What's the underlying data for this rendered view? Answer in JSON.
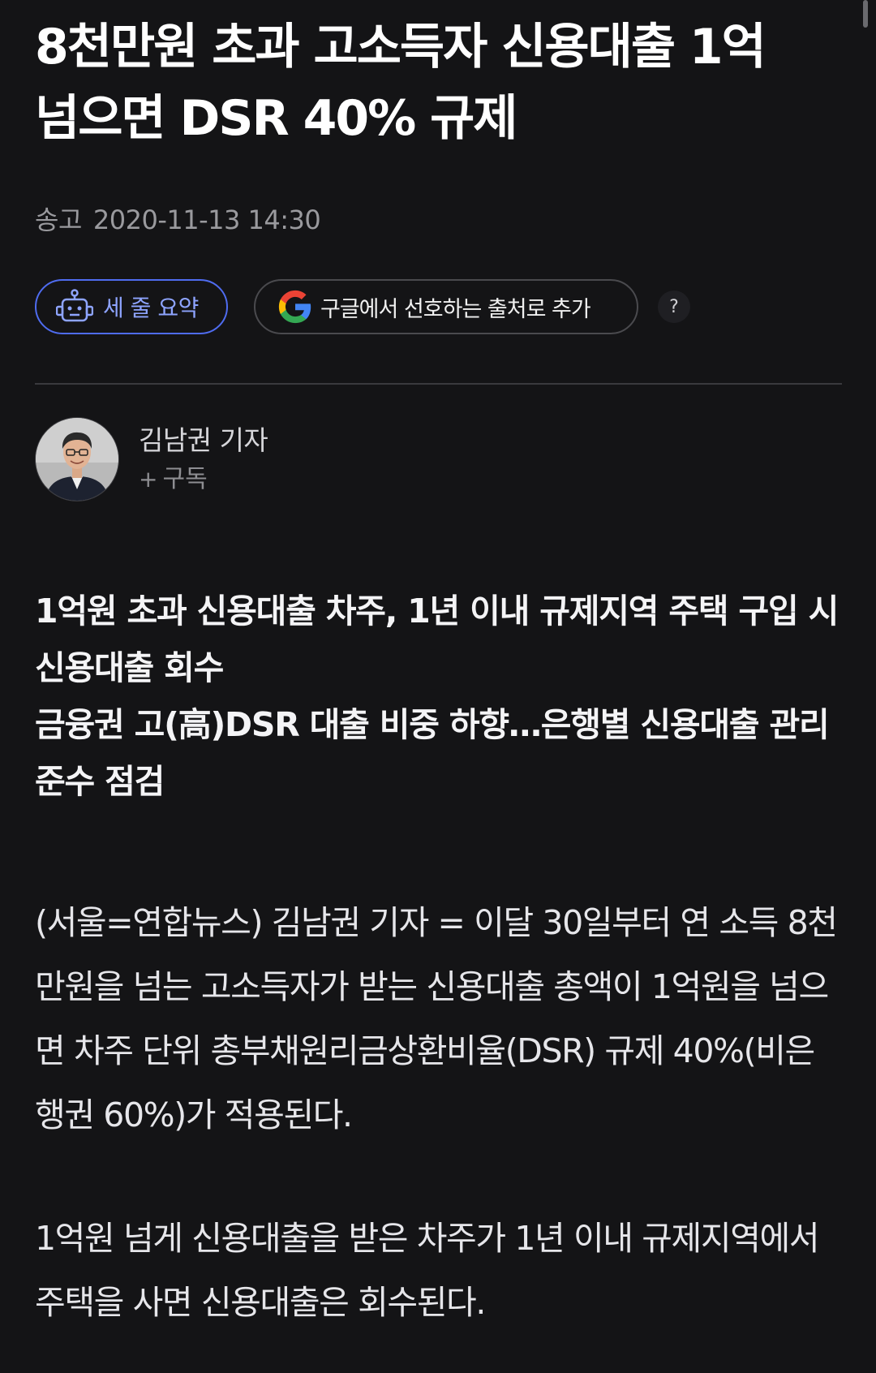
{
  "article": {
    "headline": "8천만원 초과 고소득자 신용대출 1억\n넘으면 DSR 40% 규제",
    "dateline_label": "송고",
    "dateline_value": "2020-11-13 14:30"
  },
  "actions": {
    "summary_label": "세 줄 요약",
    "google_label": "구글에서 선호하는 출처로 추가",
    "help_label": "?"
  },
  "author": {
    "name": "김남권 기자",
    "subscribe_label": "구독"
  },
  "subheads": [
    "1억원 초과 신용대출 차주, 1년 이내 규제지역 주택 구입 시 신용대출 회수",
    "금융권 고(高)DSR 대출 비중 하향…은행별 신용대출 관리 준수 점검"
  ],
  "body": [
    "(서울=연합뉴스) 김남권 기자 = 이달 30일부터 연 소득 8천만원을 넘는 고소득자가 받는 신용대출 총액이 1억원을 넘으면 차주 단위 총부채원리금상환비율(DSR) 규제 40%(비은행권 60%)가 적용된다.",
    "1억원 넘게 신용대출을 받은 차주가 1년 이내 규제지역에서 주택을 사면 신용대출은 회수된다."
  ],
  "icons": {
    "summary": "robot-icon",
    "google": "google-logo-icon"
  }
}
